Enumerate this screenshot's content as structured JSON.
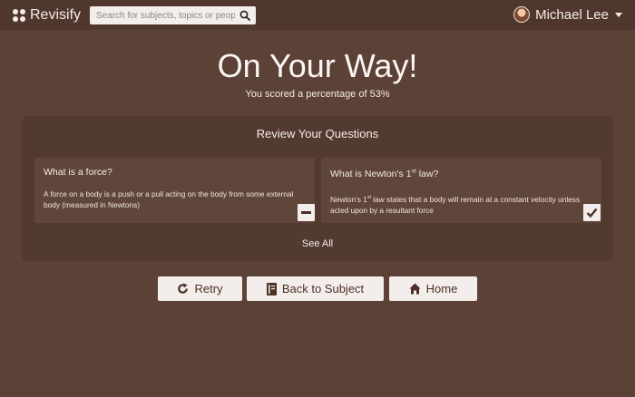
{
  "header": {
    "logo_text": "Revisify",
    "search_placeholder": "Search for subjects, topics or people",
    "user_name": "Michael Lee"
  },
  "result": {
    "title": "On Your Way!",
    "score_text": "You scored a percentage of 53%"
  },
  "review": {
    "title": "Review Your Questions",
    "cards": [
      {
        "question": "What is a force?",
        "answer": "A force on a body is a push or a pull acting on the body from some external body (measured in Newtons)",
        "status": "incorrect",
        "status_icon": "minus-icon"
      },
      {
        "question_pre": "What is Newton's 1",
        "question_sup": "st",
        "question_post": " law?",
        "answer_pre": "Newton's 1",
        "answer_sup": "st",
        "answer_post": " law states that a body will remain at a constant velocity unless acted upon by a resultant force",
        "status": "correct",
        "status_icon": "checkmark-icon"
      }
    ],
    "see_all": "See All"
  },
  "actions": {
    "retry": "Retry",
    "retry_icon": "refresh-icon",
    "back": "Back to Subject",
    "back_icon": "book-icon",
    "home": "Home",
    "home_icon": "home-icon"
  },
  "colors": {
    "background": "#5c4136",
    "topbar": "#4f372d",
    "panel": "#523a30",
    "card": "#5f453a",
    "button": "#f3eeeb",
    "button_text": "#4d3026"
  }
}
